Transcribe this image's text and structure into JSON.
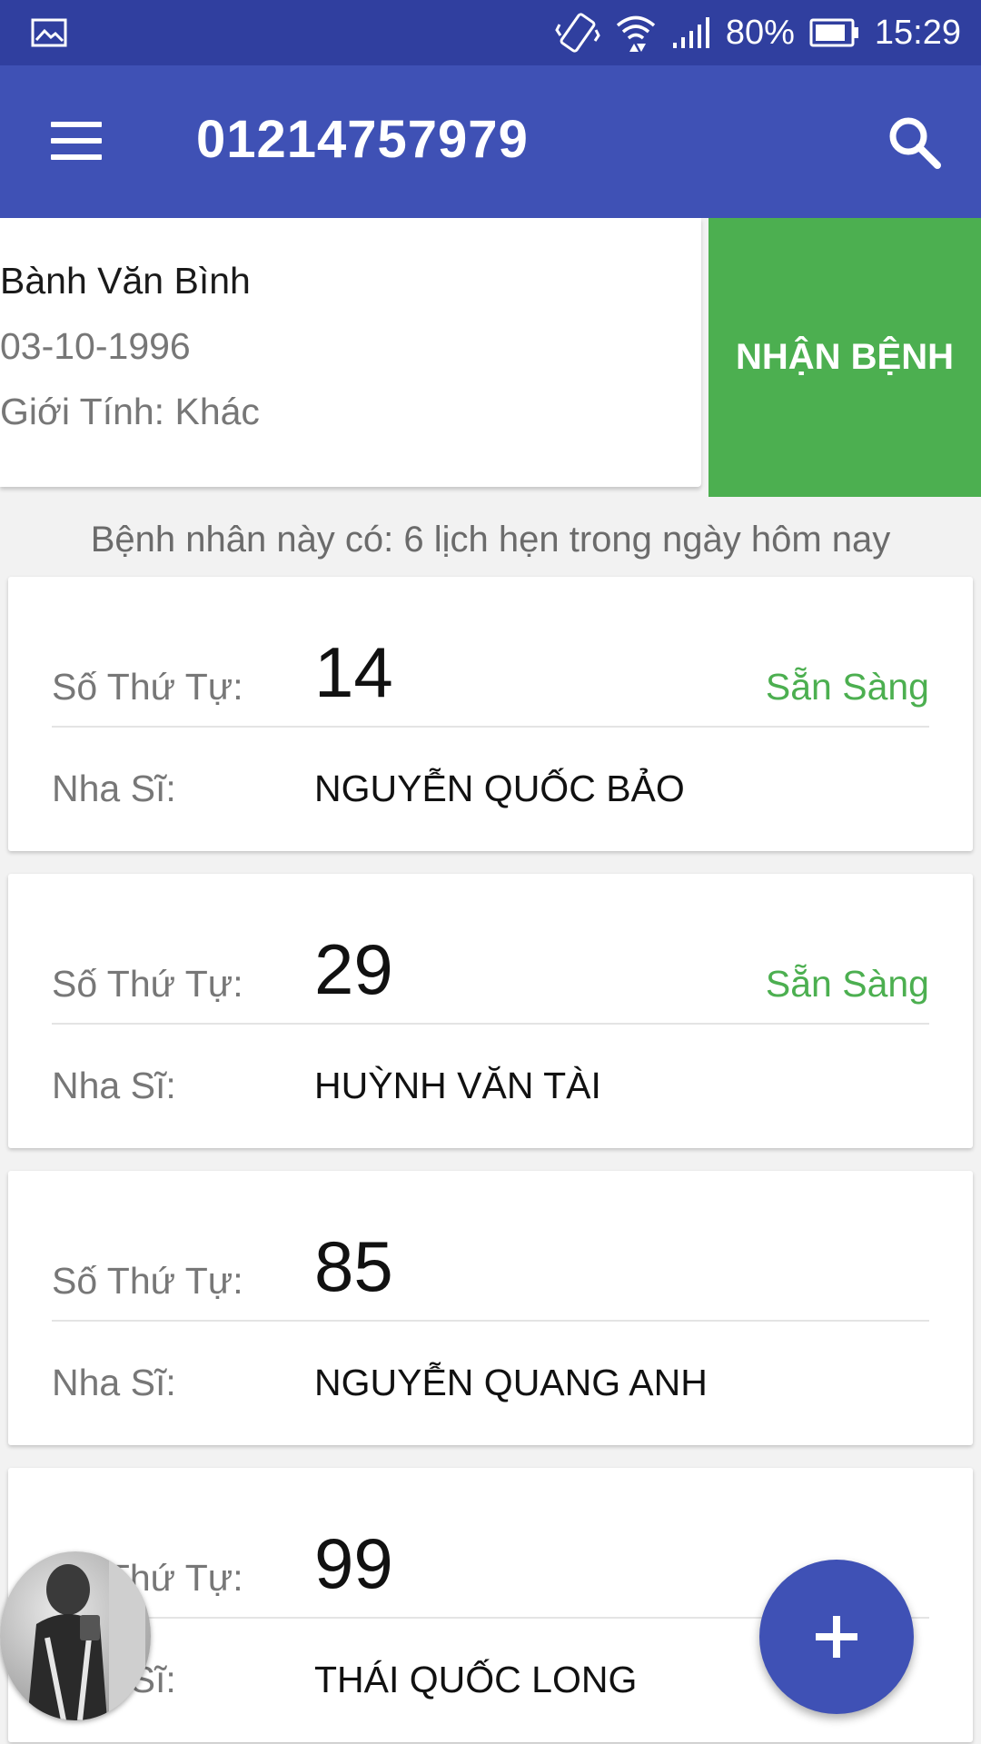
{
  "status_bar": {
    "battery": "80%",
    "time": "15:29",
    "icons": [
      "gallery-icon",
      "vibrate-icon",
      "wifi-icon",
      "signal-icon",
      "battery-icon"
    ]
  },
  "app_bar": {
    "title": "01214757979",
    "menu_icon": "menu-icon",
    "search_icon": "search-icon",
    "color": "#3f51b5"
  },
  "patient": {
    "name": "Bành Văn Bình",
    "dob": "03-10-1996",
    "gender": "Giới Tính: Khác"
  },
  "receive_button": {
    "label": "NHẬN BỆNH",
    "color": "#4caf50"
  },
  "appointments_summary": "Bệnh nhân này có: 6 lịch hẹn trong ngày hôm nay",
  "appointments": [
    {
      "order_label": "Số Thứ Tự:",
      "order": "14",
      "status": "Sẵn Sàng",
      "dentist_label": "Nha Sĩ:",
      "dentist": "NGUYỄN QUỐC BẢO"
    },
    {
      "order_label": "Số Thứ Tự:",
      "order": "29",
      "status": "Sẵn Sàng",
      "dentist_label": "Nha Sĩ:",
      "dentist": "HUỲNH VĂN TÀI"
    },
    {
      "order_label": "Số Thứ Tự:",
      "order": "85",
      "status": "",
      "dentist_label": "Nha Sĩ:",
      "dentist": "NGUYỄN QUANG ANH"
    },
    {
      "order_label": "Số Thứ Tự:",
      "order": "99",
      "status": "",
      "dentist_label": "Nha Sĩ:",
      "dentist": "THÁI QUỐC LONG"
    }
  ],
  "fab": {
    "icon": "plus-icon"
  },
  "colors": {
    "status_bar": "#303f9f",
    "accent_green": "#4caf50"
  }
}
